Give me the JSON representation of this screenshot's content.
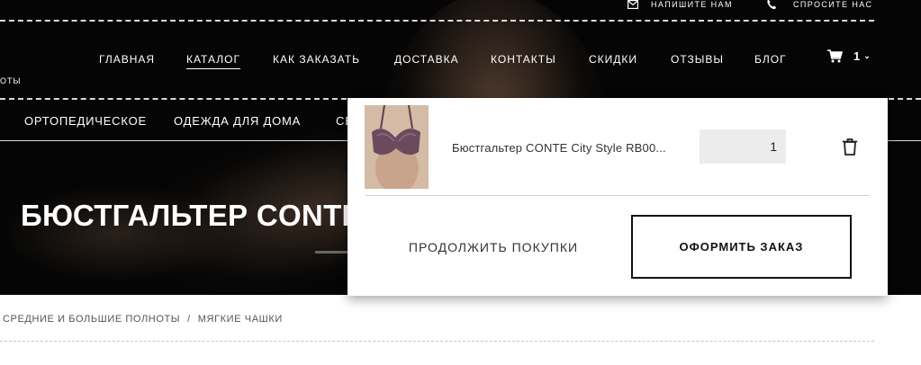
{
  "topbar": {
    "write_us": {
      "label": "НАПИШИТЕ НАМ",
      "icon": "mail-icon"
    },
    "ask_us": {
      "label": "СПРОСИТЕ НАС",
      "icon": "phone-icon"
    }
  },
  "nav": {
    "items": [
      {
        "label": "ГЛАВНАЯ"
      },
      {
        "label": "КАТАЛОГ",
        "active": true
      },
      {
        "label": "КАК ЗАКАЗАТЬ"
      },
      {
        "label": "ДОСТАВКА"
      },
      {
        "label": "КОНТАКТЫ"
      },
      {
        "label": "СКИДКИ"
      },
      {
        "label": "ОТЗЫВЫ"
      },
      {
        "label": "БЛОГ"
      }
    ],
    "cart": {
      "count": "1",
      "icon": "cart-icon"
    },
    "side_clip": "ОТЫ"
  },
  "subnav": {
    "items": [
      {
        "label": "ОРТОПЕДИЧЕСКОЕ"
      },
      {
        "label": "ОДЕЖДА ДЛЯ ДОМА"
      },
      {
        "label": "СЕ"
      }
    ]
  },
  "hero": {
    "title": "БЮСТГАЛЬТЕР CONTE"
  },
  "breadcrumb": {
    "items": [
      "СРЕДНИЕ И БОЛЬШИЕ ПОЛНОТЫ",
      "МЯГКИЕ ЧАШКИ"
    ],
    "separator": "/"
  },
  "cart_popup": {
    "item": {
      "name": "Бюстгальтер CONTE City Style RB00...",
      "quantity": "1"
    },
    "continue_label": "ПРОДОЛЖИТЬ ПОКУПКИ",
    "checkout_label": "ОФОРМИТЬ ЗАКАЗ"
  },
  "colors": {
    "hero_bg": "#050505",
    "accent": "#111111",
    "qty_bg": "#ececec"
  }
}
